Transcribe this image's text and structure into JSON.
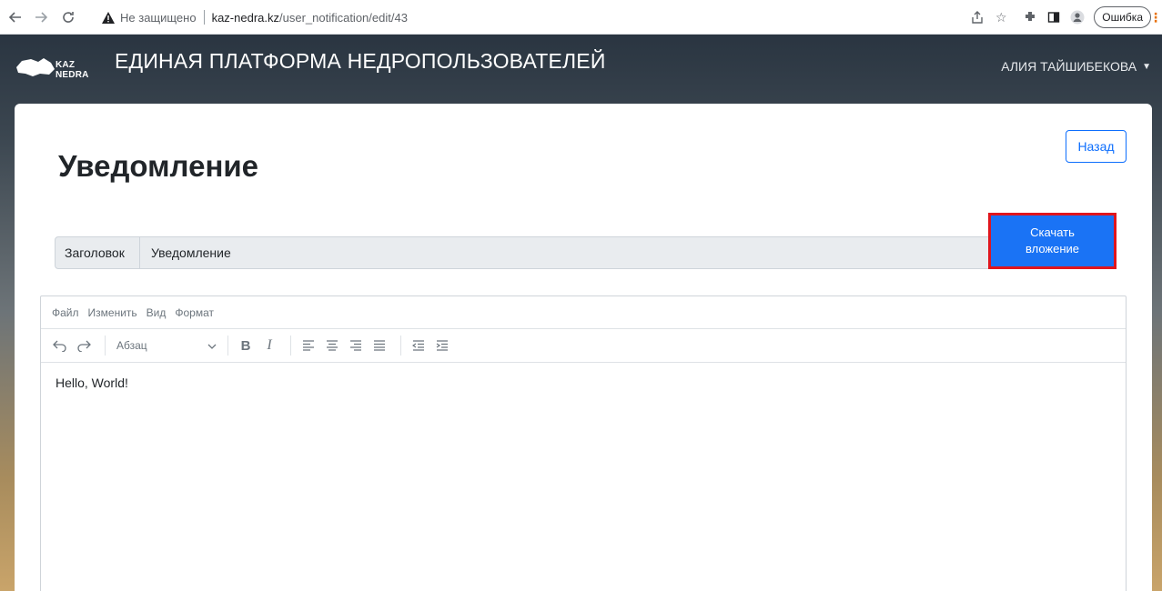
{
  "browser": {
    "not_secure_label": "Не защищено",
    "url_host": "kaz-nedra.kz",
    "url_path": "/user_notification/edit/43",
    "error_label": "Ошибка"
  },
  "header": {
    "logo_text": "KAZ NEDRA",
    "platform_title": "ЕДИНАЯ ПЛАТФОРМА НЕДРОПОЛЬЗОВАТЕЛЕЙ",
    "user_name": "АЛИЯ ТАЙШИБЕКОВА"
  },
  "page": {
    "title": "Уведомление",
    "back_label": "Назад",
    "download_line1": "Скачать",
    "download_line2": "вложение",
    "field_label": "Заголовок",
    "field_value": "Уведомление"
  },
  "editor": {
    "menu": [
      "Файл",
      "Изменить",
      "Вид",
      "Формат"
    ],
    "block_format": "Абзац",
    "content": "Hello, World!"
  },
  "colors": {
    "primary": "#0d6efd",
    "download_bg": "#1a73f5",
    "highlight_border": "#e0161d"
  }
}
